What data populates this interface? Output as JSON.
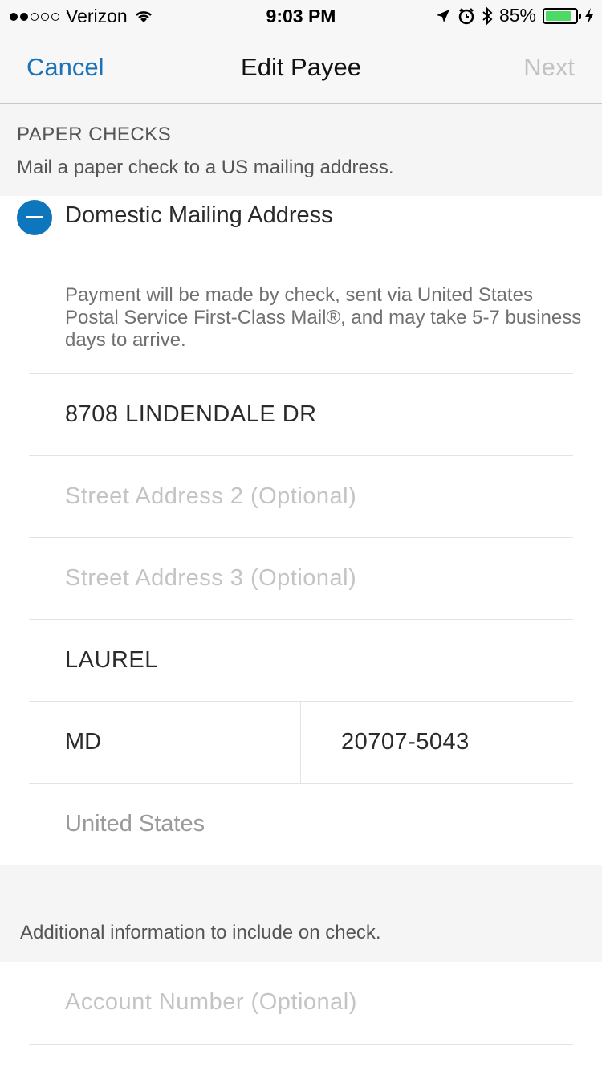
{
  "status_bar": {
    "carrier": "Verizon",
    "time": "9:03 PM",
    "battery": "85%",
    "battery_level": 0.85,
    "signal_bars_filled": 2,
    "signal_bars_total": 5
  },
  "nav": {
    "cancel": "Cancel",
    "title": "Edit Payee",
    "next": "Next"
  },
  "section": {
    "title": "PAPER CHECKS",
    "subtitle": "Mail a paper check to a US mailing address."
  },
  "option": {
    "label": "Domestic Mailing Address",
    "icon": "minus-circle-icon"
  },
  "disclaimer": "Payment will be made by check, sent via United States Postal Service First-Class Mail®, and may take 5-7 business days to arrive.",
  "address": {
    "street1": "8708 LINDENDALE DR",
    "street2_placeholder": "Street Address 2 (Optional)",
    "street3_placeholder": "Street Address 3 (Optional)",
    "city": "LAUREL",
    "state": "MD",
    "zip": "20707-5043",
    "country": "United States"
  },
  "additional": {
    "text": "Additional information to include on check.",
    "account_placeholder": "Account Number (Optional)"
  },
  "colors": {
    "accent": "#1a73b8",
    "icon_blue": "#0d76bd",
    "battery_green": "#4cd964"
  }
}
